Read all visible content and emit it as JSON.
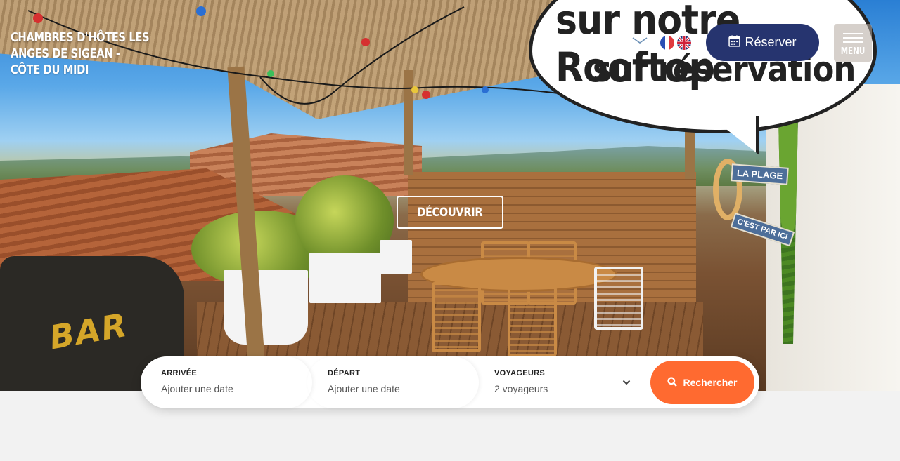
{
  "brand": {
    "line1": "CHAMBRES D'HÔTES LES ANGES DE SIGEAN -",
    "line2": "CÔTE DU MIDI"
  },
  "header": {
    "reserve_label": "Réserver",
    "menu_label": "MENU",
    "icons": [
      "phone-icon",
      "envelope-icon",
      "flag-fr-icon",
      "flag-uk-icon",
      "calendar-icon",
      "hamburger-icon"
    ],
    "reserve_color": "#26346f"
  },
  "hero": {
    "bubble_line1": "sur notre Rooftop",
    "bubble_line2": "sur réservation",
    "discover_label": "DÉCOUVRIR",
    "bar_sign": "BAR",
    "sign_plage": "LA PLAGE",
    "sign_cest": "C'EST PAR ICI"
  },
  "search": {
    "arrival_label": "ARRIVÉE",
    "arrival_placeholder": "Ajouter une date",
    "departure_label": "DÉPART",
    "departure_placeholder": "Ajouter une date",
    "guests_label": "VOYAGEURS",
    "guests_value": "2 voyageurs",
    "search_label": "Rechercher",
    "search_color": "#ff6a30"
  }
}
